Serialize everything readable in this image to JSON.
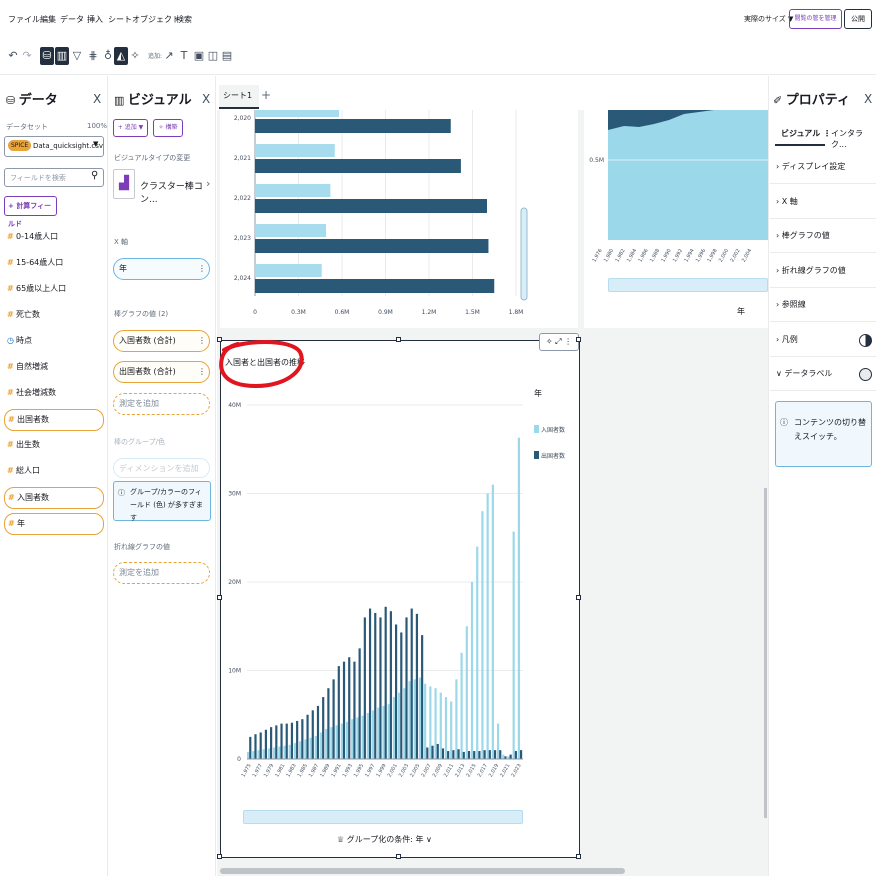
{
  "menu": [
    "ファイル",
    "編集",
    "データ",
    "挿入",
    "シート",
    "オブジェクト",
    "検索"
  ],
  "top_right": {
    "size_label": "実際のサイズ ▼",
    "manage_label": "閲覧の管を管理",
    "publish_label": "公開"
  },
  "toolbar": {
    "add_label": "追加:"
  },
  "data_panel": {
    "title": "データ",
    "dataset_label": "データセット",
    "dataset_pct": "100%",
    "spice_badge": "SPICE",
    "dataset_name": "Data_quicksight.csv",
    "search_placeholder": "フィールドを検索",
    "calc_field_label": "計算フィールド",
    "fields": [
      {
        "label": "0-14歳人口",
        "type": "measure",
        "highlight": false
      },
      {
        "label": "15-64歳人口",
        "type": "measure",
        "highlight": false
      },
      {
        "label": "65歳以上人口",
        "type": "measure",
        "highlight": false
      },
      {
        "label": "死亡数",
        "type": "measure",
        "highlight": false
      },
      {
        "label": "時点",
        "type": "time",
        "highlight": false
      },
      {
        "label": "自然増減",
        "type": "measure",
        "highlight": false
      },
      {
        "label": "社会増減数",
        "type": "measure",
        "highlight": false
      },
      {
        "label": "出国者数",
        "type": "measure",
        "highlight": true
      },
      {
        "label": "出生数",
        "type": "measure",
        "highlight": false
      },
      {
        "label": "総人口",
        "type": "measure",
        "highlight": false
      },
      {
        "label": "入国者数",
        "type": "measure",
        "highlight": true
      },
      {
        "label": "年",
        "type": "measure",
        "highlight": true
      }
    ]
  },
  "visual_panel": {
    "title": "ビジュアル",
    "add_label": "+ 追加 ▼",
    "build_label": "構築",
    "change_type_label": "ビジュアルタイプの変更",
    "visual_type": "クラスター棒コン...",
    "x_axis_label": "X 軸",
    "x_axis_value": "年",
    "bars_label": "棒グラフの値 (2)",
    "bar_fields": [
      "入国者数 (合計)",
      "出国者数 (合計)"
    ],
    "add_measure": "測定を追加",
    "group_label": "棒のグループ/色",
    "add_dimension": "ディメンションを追加",
    "info_text": "グループ/カラーのフィールド (色) が多すぎます",
    "lines_label": "折れ線グラフの値",
    "add_measure2": "測定を追加"
  },
  "sheet": {
    "tab_label": "シート1",
    "add_tab": "+"
  },
  "top_chart": {
    "rows": [
      {
        "year": "2,020",
        "v1": 0.58,
        "v2": 1.35
      },
      {
        "year": "2,021",
        "v1": 0.55,
        "v2": 1.42
      },
      {
        "year": "2,022",
        "v1": 0.52,
        "v2": 1.6
      },
      {
        "year": "2,023",
        "v1": 0.49,
        "v2": 1.61
      },
      {
        "year": "2,024",
        "v1": 0.46,
        "v2": 1.65
      }
    ],
    "x_ticks": [
      "0",
      "0.3M",
      "0.6M",
      "0.9M",
      "1.2M",
      "1.5M",
      "1.8M"
    ],
    "xmax": 1.8
  },
  "top_right_chart": {
    "ytick": "0.5M",
    "xlabel": "年",
    "x_ticks": [
      "1,976",
      "1,980",
      "1,982",
      "1,984",
      "1,986",
      "1,988",
      "1,990",
      "1,992",
      "1,994",
      "1,996",
      "1,998",
      "2,000",
      "2,002",
      "2,004"
    ]
  },
  "chart_data": {
    "type": "bar",
    "title": "入国者と出国者の推移",
    "legend_title": "年",
    "ylim": [
      0,
      40
    ],
    "y_ticks": [
      "0",
      "10M",
      "20M",
      "30M",
      "40M"
    ],
    "x_tick_labels": [
      "1,975",
      "1,977",
      "1,979",
      "1,981",
      "1,983",
      "1,985",
      "1,987",
      "1,989",
      "1,991",
      "1,993",
      "1,995",
      "1,997",
      "1,999",
      "2,001",
      "2,003",
      "2,005",
      "2,007",
      "2,009",
      "2,011",
      "2,013",
      "2,015",
      "2,017",
      "2,019",
      "2,021",
      "2,023"
    ],
    "series": [
      {
        "name": "入国者数",
        "color": "#9bd8ea",
        "values": [
          0.8,
          0.9,
          1.0,
          1.1,
          1.2,
          1.3,
          1.4,
          1.5,
          1.6,
          1.8,
          2.0,
          2.2,
          2.4,
          2.6,
          3.0,
          3.4,
          3.6,
          3.8,
          4.0,
          4.2,
          4.5,
          4.7,
          4.9,
          5.2,
          5.5,
          5.8,
          6.0,
          6.2,
          7.0,
          7.5,
          8.0,
          8.8,
          9.0,
          9.2,
          8.5,
          8.2,
          8.0,
          7.5,
          7.0,
          6.5,
          9.0,
          12.0,
          15.0,
          20.0,
          24.0,
          28.0,
          30.0,
          31.0,
          4.0,
          0.5,
          0.3,
          25.7,
          36.3
        ]
      },
      {
        "name": "出国者数",
        "color": "#2a5978",
        "values": [
          2.5,
          2.8,
          3.0,
          3.3,
          3.6,
          3.8,
          4.0,
          4.0,
          4.1,
          4.3,
          4.5,
          5.0,
          5.5,
          6.0,
          7.0,
          8.0,
          9.0,
          10.5,
          11.0,
          11.5,
          11.0,
          12.5,
          16.0,
          17.0,
          16.5,
          16.0,
          17.2,
          16.7,
          15.2,
          14.3,
          16.0,
          17.0,
          16.4,
          14.0,
          1.3,
          1.5,
          1.7,
          1.2,
          0.9,
          1.0,
          1.1,
          0.8,
          0.9,
          0.9,
          0.9,
          1.0,
          1.0,
          1.0,
          1.0,
          0.3,
          0.5,
          0.9,
          1.0
        ]
      }
    ]
  },
  "group_by_label": "グループ化の条件: 年 ∨",
  "properties": {
    "title": "プロパティ",
    "tab_visual": "ビジュアル",
    "tab_interact": "インタラク...",
    "rows": [
      "ディスプレイ設定",
      "X 軸",
      "棒グラフの値",
      "折れ線グラフの値",
      "参照線",
      "凡例",
      "データラベル"
    ],
    "info_text": "コンテンツの切り替えスイッチ。"
  }
}
